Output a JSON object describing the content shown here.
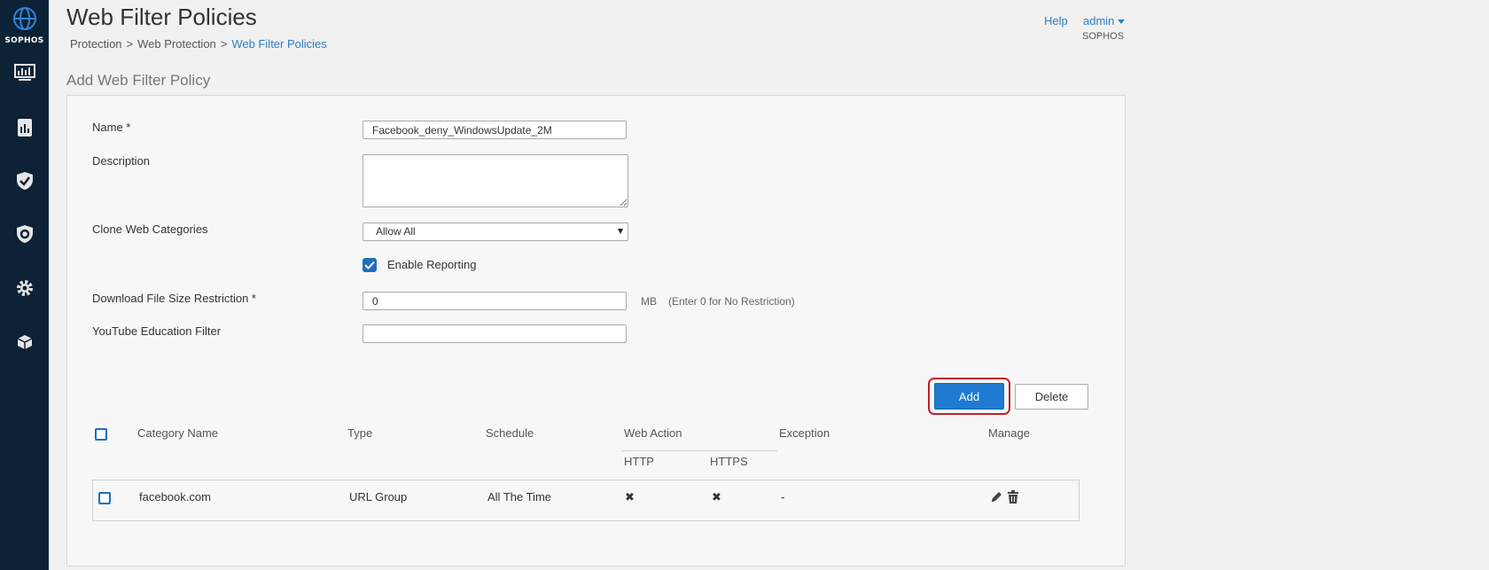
{
  "brand": {
    "name": "SOPHOS"
  },
  "sidebar": {
    "items": [
      {
        "icon": "monitor-icon"
      },
      {
        "icon": "report-icon"
      },
      {
        "icon": "shield-check-icon"
      },
      {
        "icon": "shield-gear-icon"
      },
      {
        "icon": "gear-icon"
      },
      {
        "icon": "box-icon"
      }
    ]
  },
  "header": {
    "title": "Web Filter Policies",
    "breadcrumb": [
      "Protection",
      "Web Protection",
      "Web Filter Policies"
    ],
    "breadcrumb_sep": ">",
    "help": "Help",
    "user": "admin",
    "org": "SOPHOS"
  },
  "form": {
    "section_title": "Add Web Filter Policy",
    "name_label": "Name *",
    "name_value": "Facebook_deny_WindowsUpdate_2M",
    "description_label": "Description",
    "description_value": "",
    "clone_label": "Clone Web Categories",
    "clone_value": "Allow All",
    "enable_reporting_label": "Enable Reporting",
    "enable_reporting_checked": true,
    "download_label": "Download File Size Restriction *",
    "download_value": "0",
    "download_unit": "MB",
    "download_hint": "(Enter 0 for No Restriction)",
    "youtube_label": "YouTube Education Filter",
    "youtube_value": ""
  },
  "actions": {
    "add": "Add",
    "delete": "Delete"
  },
  "table": {
    "headers": {
      "category": "Category Name",
      "type": "Type",
      "schedule": "Schedule",
      "web_action": "Web Action",
      "http": "HTTP",
      "https": "HTTPS",
      "exception": "Exception",
      "manage": "Manage"
    },
    "rows": [
      {
        "category": "facebook.com",
        "type": "URL Group",
        "schedule": "All The Time",
        "http": "✖",
        "https": "✖",
        "exception": "-"
      }
    ]
  },
  "colors": {
    "sidebar": "#0d2137",
    "accent": "#1f7bd1",
    "link": "#2f7dc3",
    "highlight": "#c0202a"
  }
}
